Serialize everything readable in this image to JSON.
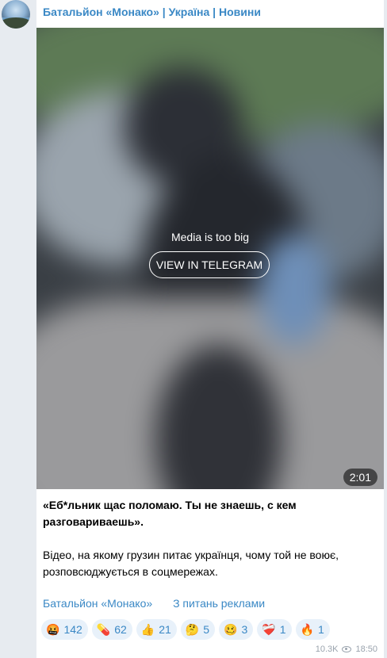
{
  "channel": {
    "title": "Батальйон «Монако» | Україна | Новини"
  },
  "media": {
    "message": "Media is too big",
    "button_label": "VIEW IN TELEGRAM",
    "duration": "2:01"
  },
  "post": {
    "bold_text": "«Еб*льник щас поломаю. Ты не знаешь, с кем разговариваешь».",
    "body_text": "Відео, на якому грузин питає українця, чому той не воює, розповсюджується в соцмережах.",
    "links": [
      {
        "label": "Батальйон «Монако»"
      },
      {
        "label": "З питань реклами"
      }
    ]
  },
  "reactions": [
    {
      "emoji": "🤬",
      "count": "142"
    },
    {
      "emoji": "💊",
      "count": "62"
    },
    {
      "emoji": "👍",
      "count": "21"
    },
    {
      "emoji": "🤔",
      "count": "5"
    },
    {
      "emoji": "🥴",
      "count": "3"
    },
    {
      "emoji": "❤️‍🩹",
      "count": "1"
    },
    {
      "emoji": "🔥",
      "count": "1"
    }
  ],
  "meta": {
    "views": "10.3K",
    "time": "18:50"
  }
}
